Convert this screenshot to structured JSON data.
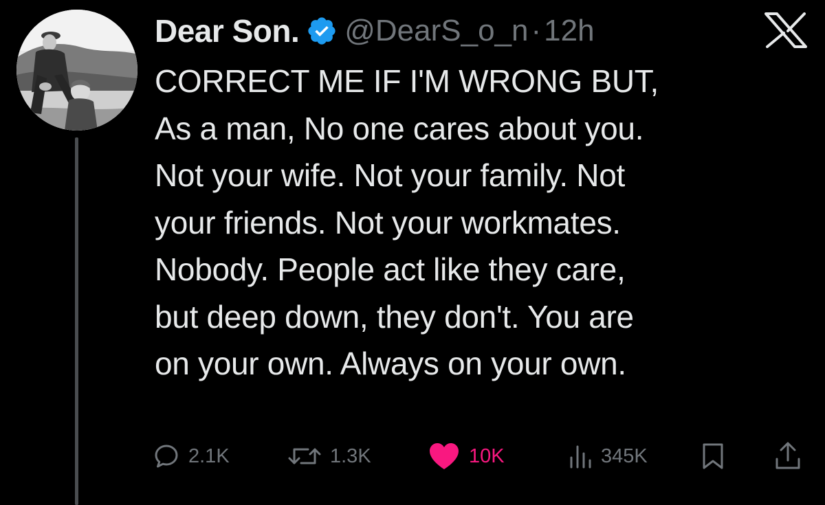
{
  "author": {
    "display_name": "Dear Son.",
    "handle": "@DearS_o_n",
    "separator": "·",
    "time": "12h",
    "verified": true,
    "verified_color": "#1d9bf0"
  },
  "tweet": {
    "lines": [
      "CORRECT ME IF I'M WRONG BUT,",
      "As a man, No one cares about you.",
      "Not your wife. Not your family. Not",
      "your friends. Not your workmates.",
      "Nobody. People act like they care,",
      "but deep down, they don't. You are",
      "on your own. Always on your own."
    ]
  },
  "actions": {
    "replies": "2.1K",
    "reposts": "1.3K",
    "likes": "10K",
    "views": "345K",
    "liked": true,
    "like_color": "#f91880"
  },
  "icons": {
    "platform": "x-logo-icon",
    "reply": "speech-bubble-icon",
    "repost": "repost-arrows-icon",
    "like": "heart-icon",
    "views": "bar-chart-icon",
    "bookmark": "bookmark-icon",
    "share": "share-upload-icon"
  },
  "colors": {
    "background": "#000000",
    "text": "#e7e9ea",
    "muted": "#71767b",
    "thread_line": "#4a4d50"
  }
}
